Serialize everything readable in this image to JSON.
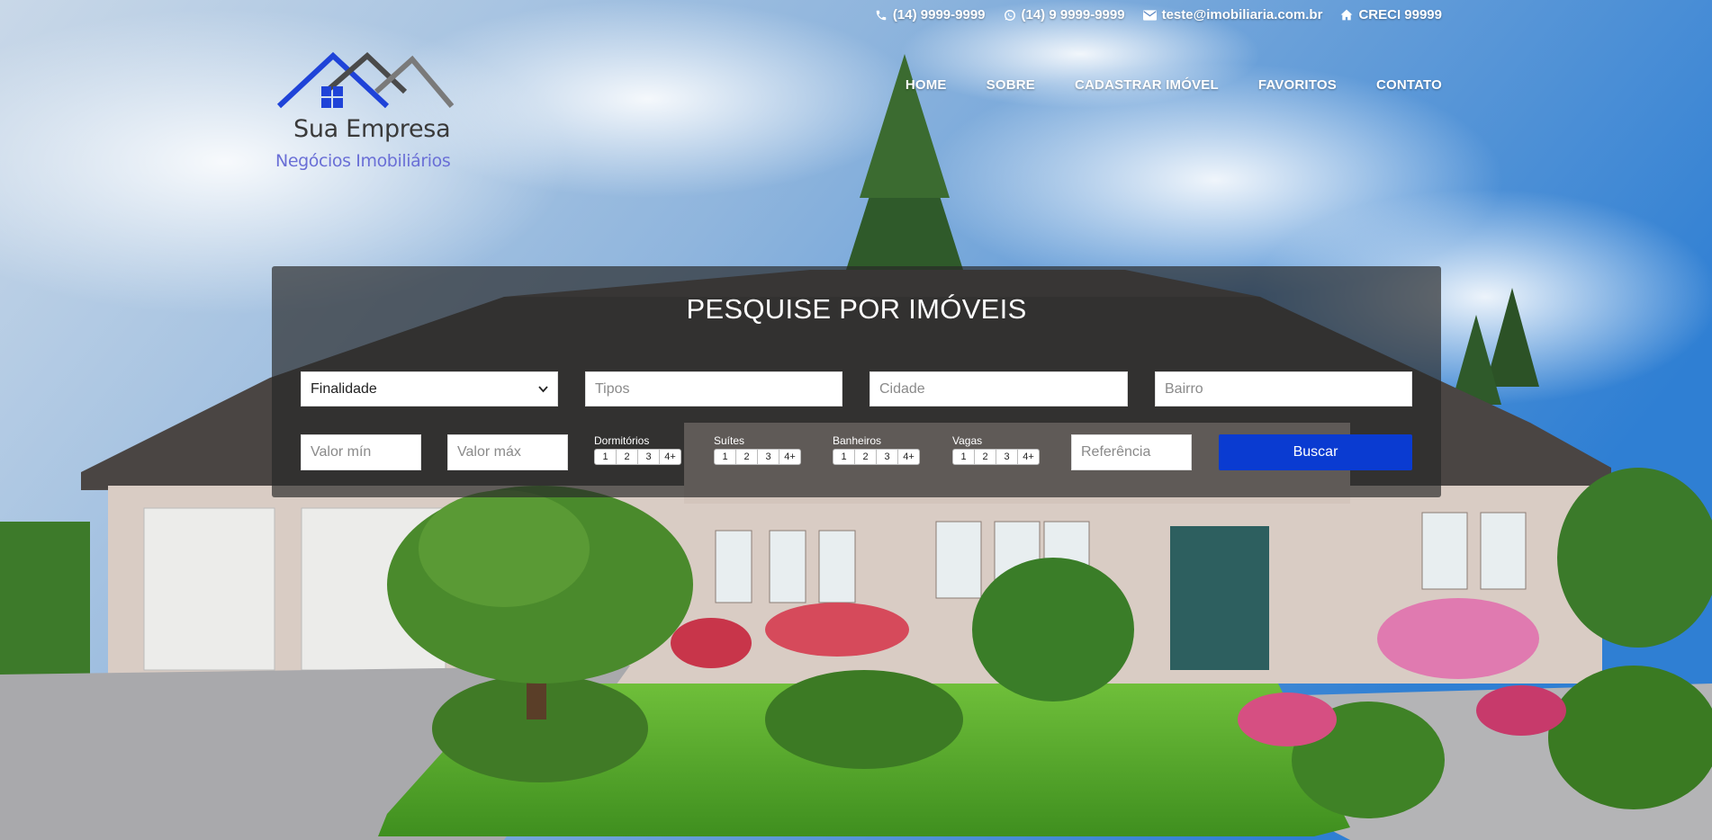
{
  "topbar": {
    "phone": "(14) 9999-9999",
    "whatsapp": "(14) 9 9999-9999",
    "email": "teste@imobiliaria.com.br",
    "creci": "CRECI 99999"
  },
  "logo": {
    "name": "Sua Empresa",
    "tagline": "Negócios Imobiliários"
  },
  "nav": {
    "items": [
      "HOME",
      "SOBRE",
      "CADASTRAR IMÓVEL",
      "FAVORITOS",
      "CONTATO"
    ]
  },
  "search": {
    "title": "PESQUISE POR IMÓVEIS",
    "finalidade": "Finalidade",
    "tipos_placeholder": "Tipos",
    "cidade_placeholder": "Cidade",
    "bairro_placeholder": "Bairro",
    "valor_min_placeholder": "Valor mín",
    "valor_max_placeholder": "Valor máx",
    "dormitorios_label": "Dormitórios",
    "suites_label": "Suítes",
    "banheiros_label": "Banheiros",
    "vagas_label": "Vagas",
    "options": [
      "1",
      "2",
      "3",
      "4+"
    ],
    "referencia_placeholder": "Referência",
    "buscar_label": "Buscar"
  },
  "colors": {
    "accent": "#0a3bd1",
    "logo_blue": "#1f43d8",
    "logo_gray": "#4a4a4a"
  },
  "icons": [
    "phone-icon",
    "whatsapp-icon",
    "envelope-icon",
    "home-icon",
    "chevron-down-icon"
  ]
}
